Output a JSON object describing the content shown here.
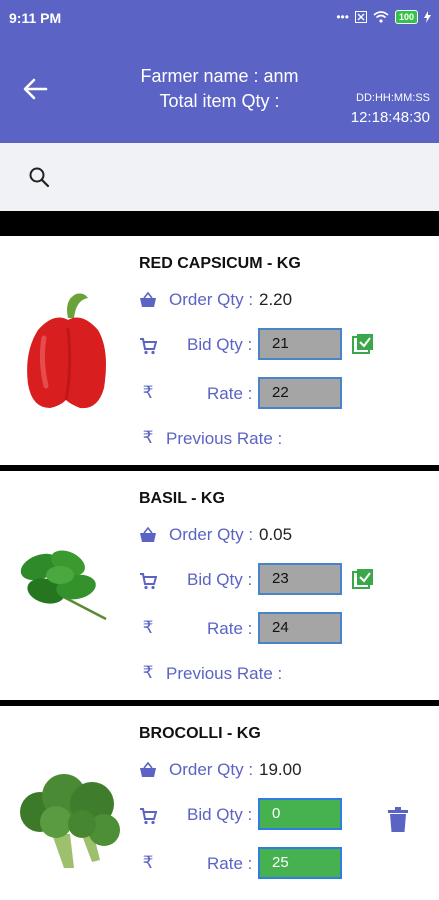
{
  "status_bar": {
    "time": "9:11 PM",
    "icons": [
      "dots-icon",
      "close-box-icon",
      "wifi-icon",
      "battery-icon",
      "charging-icon"
    ],
    "battery": "100"
  },
  "header": {
    "farmer_name": "Farmer name : anm",
    "total_item_qty": "Total item Qty :",
    "countdown_label": "DD:HH:MM:SS",
    "countdown_value": "12:18:48:30"
  },
  "search": {
    "icon": "search-icon"
  },
  "labels": {
    "order_qty": "Order Qty :",
    "bid_qty": "Bid Qty :",
    "rate": "Rate :",
    "previous_rate": "Previous Rate :",
    "rupee": "₹"
  },
  "products": [
    {
      "title": "RED CAPSICUM - KG",
      "order_qty": "2.20",
      "bid_qty": "21",
      "rate": "22",
      "action": "check-icon"
    },
    {
      "title": "BASIL - KG",
      "order_qty": "0.05",
      "bid_qty": "23",
      "rate": "24",
      "action": "check-icon"
    },
    {
      "title": "BROCOLLI - KG",
      "order_qty": "19.00",
      "bid_qty": "0",
      "rate": "25",
      "action": "delete-icon"
    }
  ],
  "colors": {
    "primary": "#5b63c4",
    "input_grey": "#a5a5a5",
    "input_green": "#45b24f",
    "check_green": "#3aa84a"
  }
}
